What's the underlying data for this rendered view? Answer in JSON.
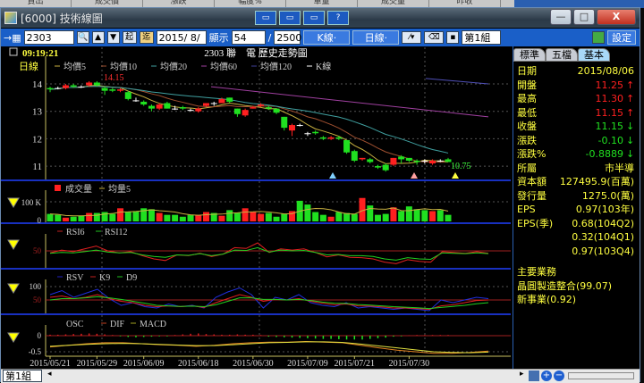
{
  "background_header": [
    "買出",
    "成交價",
    "漲跌",
    "幅度%",
    "單量",
    "成交量",
    "昨收",
    "最高",
    "最低"
  ],
  "window": {
    "title": "[6000] 技術線圖",
    "tool_buttons": [
      "▭",
      "▭",
      "▭",
      "?"
    ],
    "minimize": "—",
    "maximize": "□",
    "close": "X"
  },
  "toolbar": {
    "symbol": "2303",
    "date": "2015/ 8/",
    "show_label": "顯示",
    "show_count": "54",
    "total": "2500",
    "kline": "K線·",
    "dayline": "日線·",
    "start_label": "起",
    "end_label": "迄",
    "layer": "第1組",
    "settings": "設定"
  },
  "chart": {
    "time": "09:19:21",
    "title": "2303 聯　電 歷史走勢圖",
    "period": "日線",
    "legend": [
      "均價5",
      "均價10",
      "均價20",
      "均價60",
      "均價120",
      "K線"
    ],
    "legend_colors": [
      "#c8b040",
      "#a05030",
      "#40a0a0",
      "#a040a0",
      "#404098",
      "#ffffff"
    ],
    "high_label": "14.15",
    "low_label": "10.75",
    "vol_legend": [
      "成交量",
      "均量5"
    ],
    "vol_ticks": [
      "100 K",
      "0"
    ],
    "rsi_legend": [
      "RSI6",
      "RSI12"
    ],
    "rsi_tick": "50",
    "kd_legend": [
      "RSV",
      "K9",
      "D9"
    ],
    "kd_ticks": [
      "100",
      "50"
    ],
    "macd_legend": [
      "OSC",
      "DIF",
      "MACD"
    ],
    "macd_ticks": [
      "0",
      "-0.5"
    ]
  },
  "chart_data": {
    "type": "candlestick",
    "ohlc": [
      [
        13.85,
        13.9,
        13.7,
        13.8
      ],
      [
        13.85,
        13.9,
        13.8,
        13.85
      ],
      [
        13.85,
        14.0,
        13.8,
        13.95
      ],
      [
        13.95,
        14.0,
        13.85,
        13.9
      ],
      [
        13.9,
        13.95,
        13.85,
        13.9
      ],
      [
        13.95,
        14.1,
        13.9,
        14.05
      ],
      [
        14.05,
        14.1,
        13.9,
        13.95
      ],
      [
        13.85,
        13.9,
        13.6,
        13.75
      ],
      [
        13.8,
        13.85,
        13.7,
        13.75
      ],
      [
        13.75,
        13.85,
        13.7,
        13.8
      ],
      [
        13.7,
        13.75,
        13.4,
        13.45
      ],
      [
        13.4,
        13.5,
        13.35,
        13.4
      ],
      [
        13.35,
        13.4,
        13.2,
        13.25
      ],
      [
        13.2,
        13.25,
        13.0,
        13.1
      ],
      [
        13.1,
        13.3,
        13.05,
        13.25
      ],
      [
        13.3,
        13.35,
        13.1,
        13.1
      ],
      [
        13.1,
        13.2,
        13.05,
        13.1
      ],
      [
        13.15,
        13.2,
        13.05,
        13.1
      ],
      [
        13.05,
        13.1,
        13.0,
        13.05
      ],
      [
        13.0,
        13.15,
        12.95,
        13.1
      ],
      [
        13.2,
        13.3,
        13.15,
        13.3
      ],
      [
        13.3,
        13.35,
        13.2,
        13.3
      ],
      [
        13.3,
        13.5,
        13.3,
        13.45
      ],
      [
        13.5,
        13.5,
        13.3,
        13.35
      ],
      [
        13.1,
        13.1,
        12.8,
        12.9
      ],
      [
        12.85,
        13.1,
        12.8,
        13.05
      ],
      [
        13.1,
        13.2,
        13.1,
        13.15
      ],
      [
        13.2,
        13.3,
        13.15,
        13.25
      ],
      [
        13.15,
        13.2,
        13.05,
        13.1
      ],
      [
        13.1,
        13.1,
        12.9,
        12.95
      ],
      [
        12.8,
        12.8,
        12.3,
        12.4
      ],
      [
        12.3,
        12.55,
        12.1,
        12.5
      ],
      [
        12.5,
        12.55,
        12.45,
        12.5
      ],
      [
        12.2,
        12.25,
        12.1,
        12.2
      ],
      [
        12.25,
        12.3,
        12.15,
        12.2
      ],
      [
        12.05,
        12.1,
        11.95,
        12.0
      ],
      [
        12.0,
        12.1,
        11.95,
        12.05
      ],
      [
        12.05,
        12.1,
        11.95,
        12.0
      ],
      [
        11.95,
        11.95,
        11.45,
        11.5
      ],
      [
        11.55,
        11.6,
        11.15,
        11.2
      ],
      [
        11.25,
        11.3,
        11.2,
        11.3
      ],
      [
        11.25,
        11.3,
        11.1,
        11.15
      ],
      [
        11.0,
        11.05,
        10.9,
        10.95
      ],
      [
        11.05,
        11.1,
        10.8,
        10.85
      ],
      [
        11.05,
        11.3,
        11.0,
        11.3
      ],
      [
        11.35,
        11.4,
        11.1,
        11.25
      ],
      [
        11.3,
        11.3,
        11.15,
        11.2
      ],
      [
        11.2,
        11.25,
        11.05,
        11.15
      ],
      [
        11.2,
        11.25,
        11.1,
        11.2
      ],
      [
        11.1,
        11.25,
        11.05,
        11.2
      ],
      [
        11.2,
        11.25,
        11.15,
        11.2
      ],
      [
        11.25,
        11.3,
        11.15,
        11.15
      ]
    ],
    "ma60": [
      13.9,
      12.8
    ],
    "ma120": [
      14.2,
      14.0
    ],
    "dates": [
      {
        "i": 0,
        "label": "2015/05/21"
      },
      {
        "i": 6,
        "label": "2015/05/29"
      },
      {
        "i": 12,
        "label": "2015/06/09"
      },
      {
        "i": 19,
        "label": "2015/06/18"
      },
      {
        "i": 26,
        "label": "2015/06/30"
      },
      {
        "i": 33,
        "label": "2015/07/09"
      },
      {
        "i": 39,
        "label": "2015/07/21"
      },
      {
        "i": 46,
        "label": "2015/07/30"
      }
    ],
    "volume_k": [
      40,
      35,
      20,
      25,
      30,
      45,
      45,
      50,
      40,
      70,
      50,
      55,
      70,
      65,
      45,
      35,
      35,
      25,
      35,
      35,
      50,
      45,
      30,
      60,
      45,
      70,
      50,
      40,
      45,
      25,
      40,
      55,
      110,
      90,
      50,
      35,
      25,
      50,
      45,
      40,
      125,
      85,
      35,
      40,
      75,
      55,
      80,
      65,
      60,
      55,
      60,
      35
    ],
    "rsi6": [
      45,
      52,
      48,
      55,
      62,
      50,
      45,
      48,
      38,
      30,
      26,
      40,
      38,
      44,
      36,
      42,
      58,
      56,
      70,
      46,
      55,
      52,
      55,
      46,
      35,
      40,
      34,
      33,
      30,
      22,
      18,
      28,
      24,
      22,
      48,
      46,
      44,
      48,
      44
    ],
    "rsi12": [
      44,
      46,
      45,
      48,
      52,
      47,
      45,
      46,
      40,
      36,
      34,
      40,
      39,
      43,
      38,
      42,
      52,
      51,
      58,
      47,
      52,
      50,
      51,
      46,
      40,
      41,
      38,
      38,
      36,
      30,
      27,
      33,
      30,
      29,
      45,
      44,
      43,
      45,
      43
    ],
    "rsv": [
      70,
      85,
      60,
      75,
      90,
      55,
      30,
      40,
      25,
      20,
      35,
      25,
      30,
      20,
      60,
      80,
      95,
      70,
      20,
      60,
      50,
      70,
      40,
      30,
      25,
      40,
      20,
      25,
      20,
      15,
      20,
      15,
      10,
      50,
      40,
      50,
      60,
      55
    ],
    "k9": [
      60,
      65,
      55,
      60,
      70,
      55,
      45,
      40,
      30,
      25,
      28,
      25,
      28,
      22,
      40,
      55,
      70,
      60,
      45,
      52,
      50,
      55,
      45,
      38,
      32,
      35,
      28,
      27,
      24,
      20,
      20,
      18,
      15,
      28,
      32,
      40,
      48,
      50
    ],
    "d9": [
      50,
      55,
      55,
      58,
      62,
      58,
      52,
      45,
      38,
      30,
      28,
      26,
      27,
      25,
      32,
      45,
      58,
      58,
      52,
      52,
      50,
      52,
      48,
      42,
      38,
      37,
      33,
      31,
      28,
      25,
      23,
      21,
      18,
      22,
      26,
      30,
      36,
      40
    ],
    "dif": [
      -0.35,
      -0.3,
      -0.25,
      -0.22,
      -0.22,
      -0.25,
      -0.28,
      -0.3,
      -0.33,
      -0.3,
      -0.25,
      -0.22,
      -0.2,
      -0.2,
      -0.18,
      -0.2,
      -0.22,
      -0.3,
      -0.38,
      -0.45,
      -0.5,
      -0.55,
      -0.55,
      -0.52,
      -0.48
    ],
    "macd": [
      -0.33,
      -0.3,
      -0.27,
      -0.25,
      -0.24,
      -0.25,
      -0.27,
      -0.29,
      -0.31,
      -0.31,
      -0.28,
      -0.25,
      -0.22,
      -0.21,
      -0.19,
      -0.19,
      -0.21,
      -0.26,
      -0.32,
      -0.38,
      -0.44,
      -0.5,
      -0.52,
      -0.53,
      -0.51
    ],
    "osc": [
      0.03,
      0.03,
      0.04,
      0.05,
      0.06,
      0.07,
      0.06,
      0.04,
      0.02,
      -0.02,
      -0.04,
      -0.05,
      -0.04,
      -0.03,
      -0.02,
      -0.02,
      0.02,
      0.04,
      0.06,
      0.07,
      0.05,
      0.04,
      0.03,
      0.03,
      0.04,
      0.03,
      0.03,
      0.02,
      -0.03,
      -0.04,
      -0.05,
      -0.06,
      -0.07,
      -0.08,
      -0.09,
      -0.1,
      -0.1,
      -0.11,
      -0.12,
      -0.12,
      -0.12,
      -0.1,
      -0.08,
      -0.06,
      -0.03,
      -0.02,
      0.01,
      0.02,
      0.02,
      0.02,
      0.02,
      0.02
    ]
  },
  "right_panel": {
    "tabs": [
      "標準",
      "五檔",
      "基本"
    ],
    "rows": [
      {
        "label": "日期",
        "value": "2015/08/06",
        "color": "y",
        "arrow": ""
      },
      {
        "label": "開盤",
        "value": "11.25",
        "color": "r",
        "arrow": "↑"
      },
      {
        "label": "最高",
        "value": "11.30",
        "color": "r",
        "arrow": "↑"
      },
      {
        "label": "最低",
        "value": "11.15",
        "color": "r",
        "arrow": "↑"
      },
      {
        "label": "收盤",
        "value": "11.15",
        "color": "g",
        "arrow": "↓"
      },
      {
        "label": "漲跌",
        "value": "-0.10",
        "color": "g",
        "arrow": "↓"
      },
      {
        "label": "漲跌%",
        "value": "-0.8889",
        "color": "g",
        "arrow": "↓"
      },
      {
        "label": "所屬",
        "value": "市半導",
        "color": "y",
        "arrow": ""
      },
      {
        "label": "資本額",
        "value": "127495.9(百萬)",
        "color": "y",
        "arrow": ""
      },
      {
        "label": "發行量",
        "value": "1275.0(萬)",
        "color": "y",
        "arrow": ""
      },
      {
        "label": "EPS",
        "value": "0.97(103年)",
        "color": "y",
        "arrow": ""
      },
      {
        "label": "EPS(季)",
        "value": "0.68(104Q2)",
        "color": "y",
        "arrow": ""
      },
      {
        "label": "",
        "value": "0.32(104Q1)",
        "color": "y",
        "arrow": ""
      },
      {
        "label": "",
        "value": "0.97(103Q4)",
        "color": "y",
        "arrow": ""
      }
    ],
    "business_title": "主要業務",
    "business": [
      "晶圓製造整合(99.07)",
      "新事業(0.92)"
    ]
  },
  "bottom": {
    "layer": "第1組"
  }
}
